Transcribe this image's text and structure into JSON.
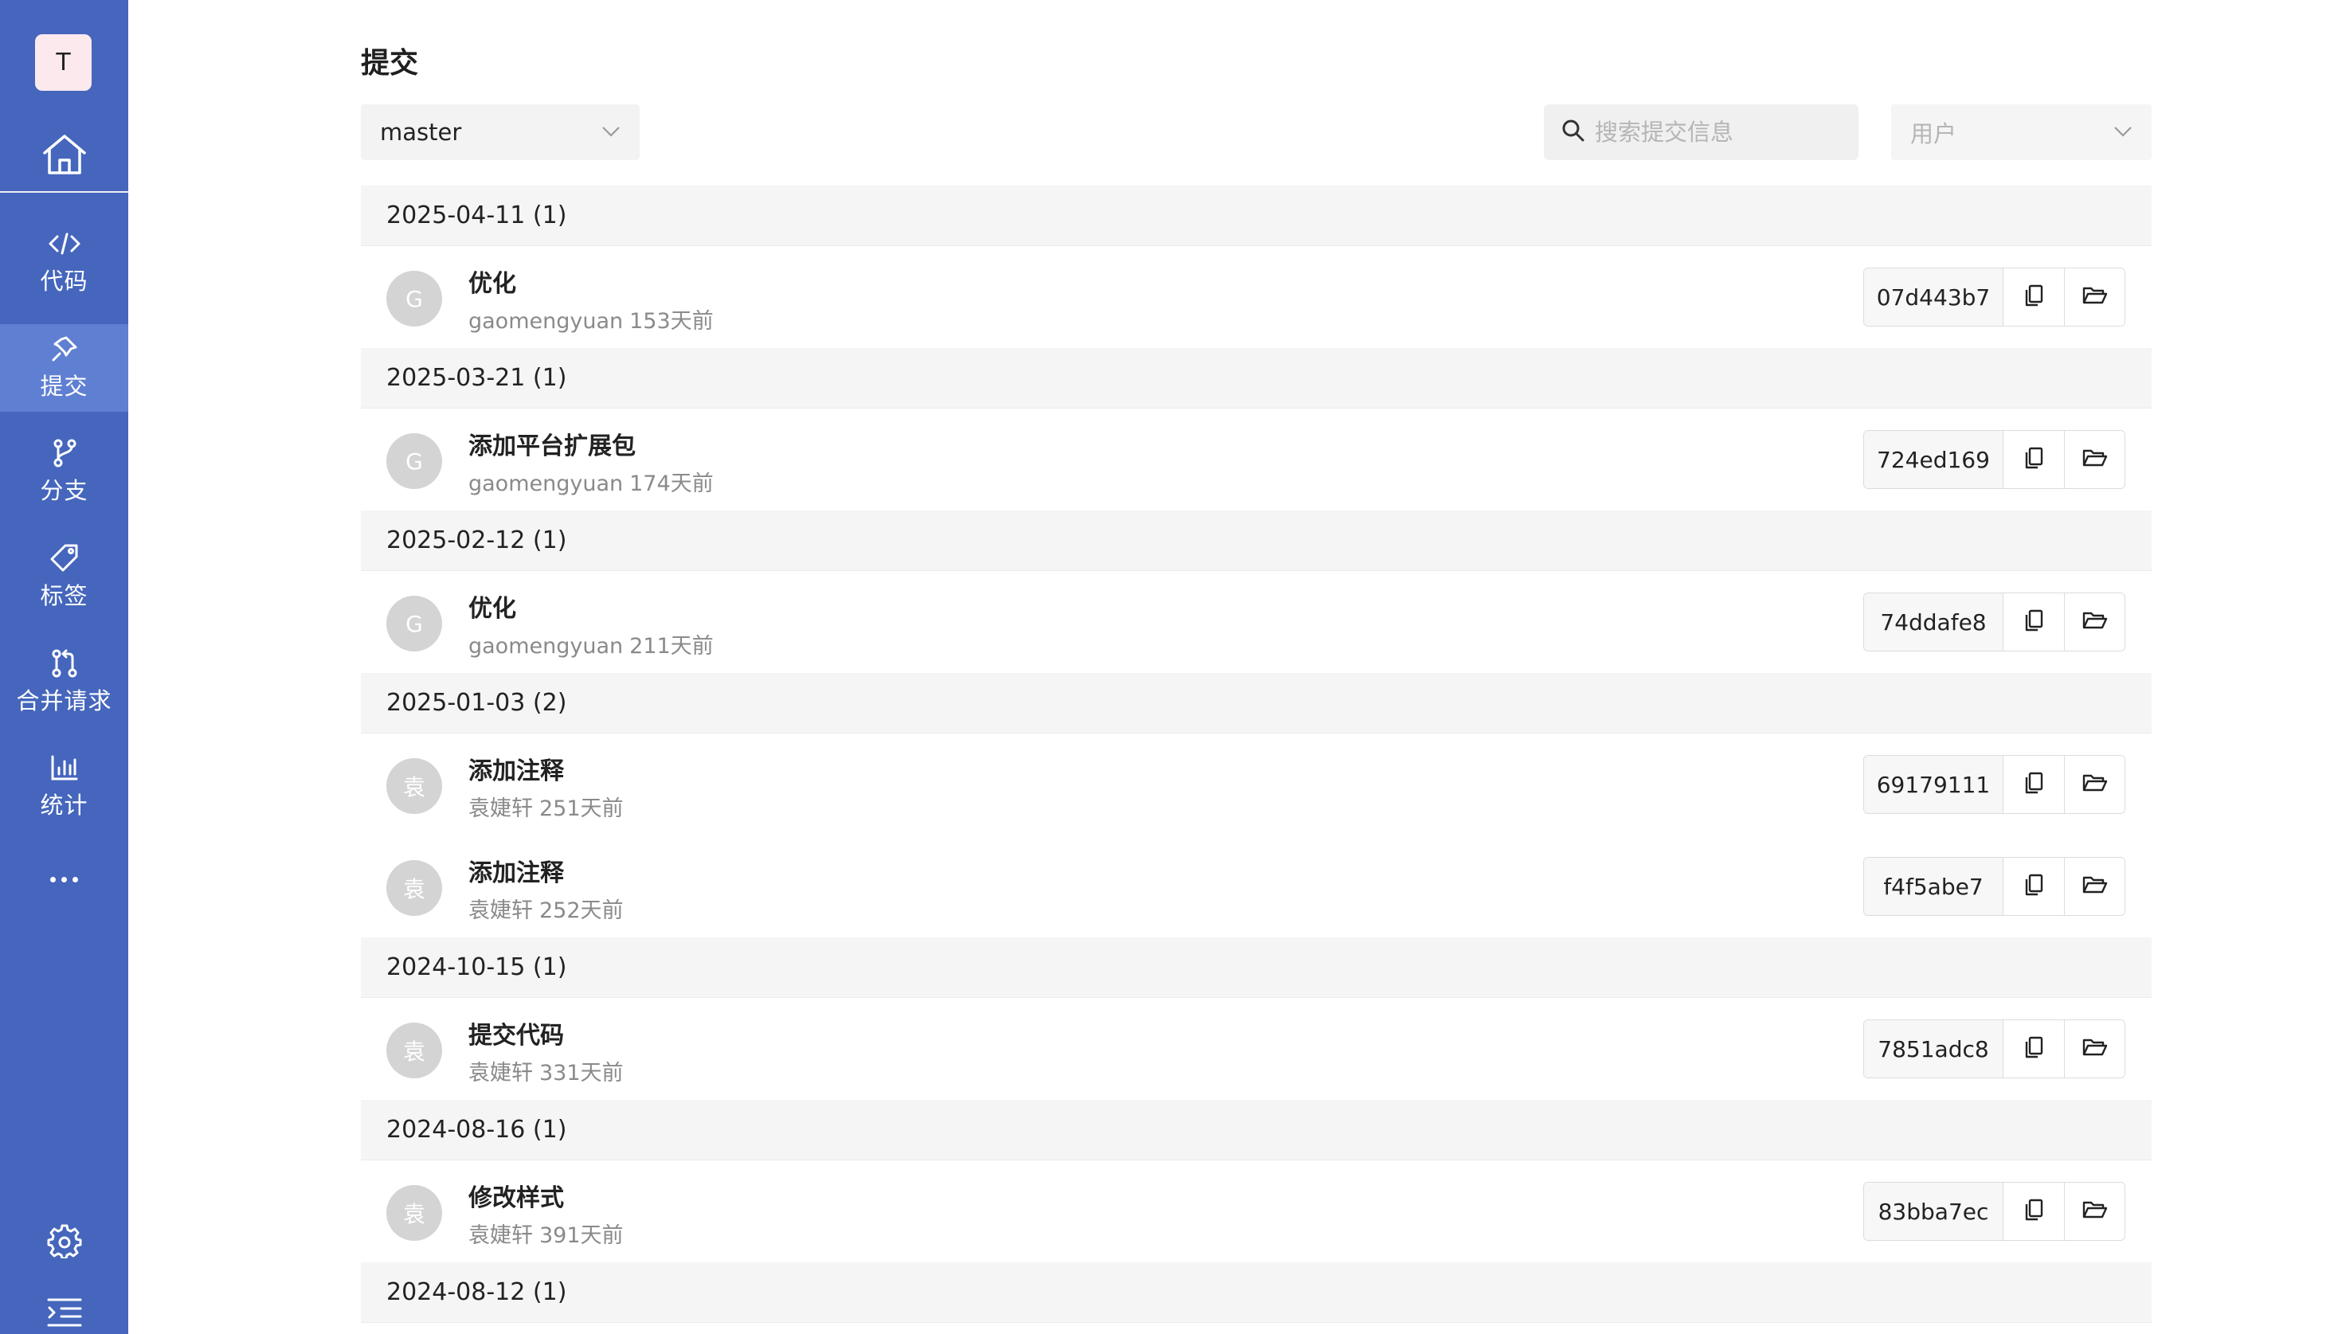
{
  "sidebar": {
    "user_initial": "T",
    "nav": [
      {
        "label": "代码",
        "icon": "code-icon"
      },
      {
        "label": "提交",
        "icon": "pin-icon",
        "active": true
      },
      {
        "label": "分支",
        "icon": "branch-icon"
      },
      {
        "label": "标签",
        "icon": "tag-icon"
      },
      {
        "label": "合并请求",
        "icon": "merge-request-icon"
      },
      {
        "label": "统计",
        "icon": "bar-chart-icon"
      }
    ]
  },
  "page": {
    "title": "提交",
    "branch": "master",
    "search_placeholder": "搜索提交信息",
    "user_placeholder": "用户"
  },
  "groups": [
    {
      "date": "2025-04-11",
      "count": "(1)",
      "commits": [
        {
          "avatar": "G",
          "message": "优化",
          "author": "gaomengyuan",
          "time": "153天前",
          "sha": "07d443b7"
        }
      ]
    },
    {
      "date": "2025-03-21",
      "count": "(1)",
      "commits": [
        {
          "avatar": "G",
          "message": "添加平台扩展包",
          "author": "gaomengyuan",
          "time": "174天前",
          "sha": "724ed169"
        }
      ]
    },
    {
      "date": "2025-02-12",
      "count": "(1)",
      "commits": [
        {
          "avatar": "G",
          "message": "优化",
          "author": "gaomengyuan",
          "time": "211天前",
          "sha": "74ddafe8"
        }
      ]
    },
    {
      "date": "2025-01-03",
      "count": "(2)",
      "commits": [
        {
          "avatar": "袁",
          "message": "添加注释",
          "author": "袁婕轩",
          "time": "251天前",
          "sha": "69179111"
        },
        {
          "avatar": "袁",
          "message": "添加注释",
          "author": "袁婕轩",
          "time": "252天前",
          "sha": "f4f5abe7"
        }
      ]
    },
    {
      "date": "2024-10-15",
      "count": "(1)",
      "commits": [
        {
          "avatar": "袁",
          "message": "提交代码",
          "author": "袁婕轩",
          "time": "331天前",
          "sha": "7851adc8"
        }
      ]
    },
    {
      "date": "2024-08-16",
      "count": "(1)",
      "commits": [
        {
          "avatar": "袁",
          "message": "修改样式",
          "author": "袁婕轩",
          "time": "391天前",
          "sha": "83bba7ec"
        }
      ]
    },
    {
      "date": "2024-08-12",
      "count": "(1)",
      "commits": []
    }
  ],
  "colors": {
    "sidebar": "#4566bc",
    "sidebar_active": "#5f7fd2",
    "date_header_bg": "#f5f5f5"
  }
}
